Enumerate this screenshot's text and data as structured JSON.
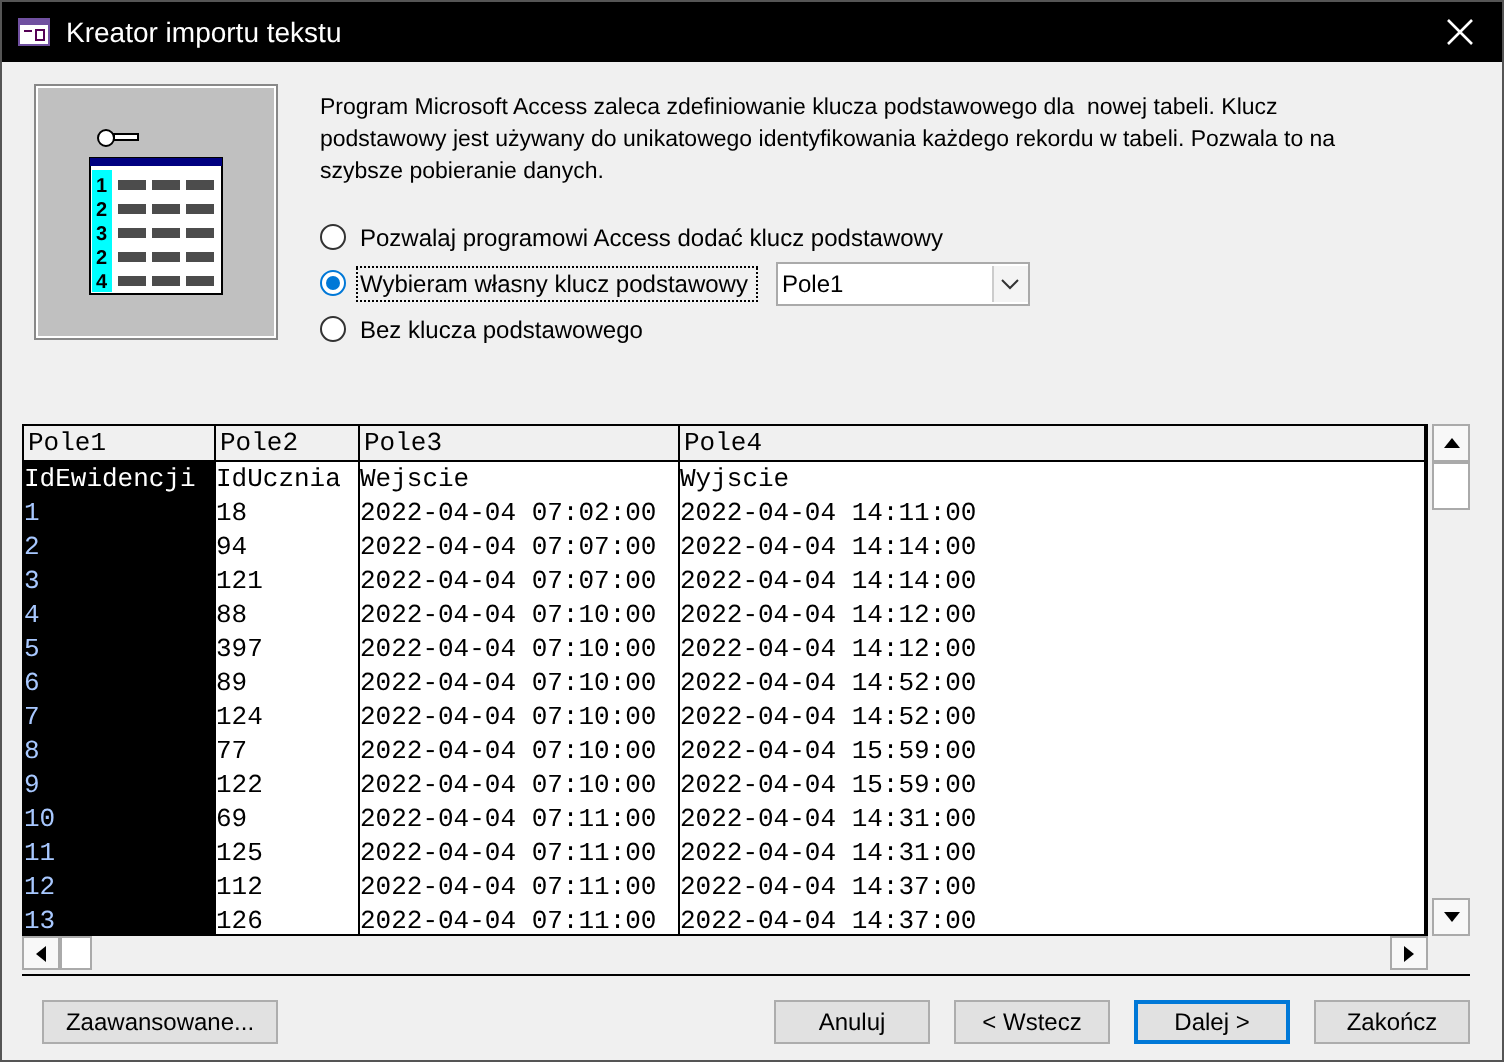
{
  "window": {
    "title": "Kreator importu tekstu"
  },
  "description": "Program Microsoft Access zaleca zdefiniowanie klucza podstawowego dla  nowej tabeli. Klucz podstawowy jest używany do unikatowego identyfikowania każdego rekordu w tabeli. Pozwala to na szybsze pobieranie danych.",
  "illustration": {
    "row_numbers": [
      "1",
      "2",
      "3",
      "2",
      "4"
    ]
  },
  "options": [
    {
      "label": "Pozwalaj programowi Access dodać klucz podstawowy",
      "selected": false
    },
    {
      "label": "Wybieram własny klucz podstawowy",
      "selected": true
    },
    {
      "label": "Bez klucza podstawowego",
      "selected": false
    }
  ],
  "key_field": {
    "value": "Pole1"
  },
  "table": {
    "columns": [
      {
        "label": "Pole1",
        "selected": true
      },
      {
        "label": "Pole2",
        "selected": false
      },
      {
        "label": "Pole3",
        "selected": false
      },
      {
        "label": "Pole4",
        "selected": false
      }
    ],
    "rows": [
      [
        "IdEwidencji",
        "IdUcznia",
        "Wejscie",
        "Wyjscie"
      ],
      [
        "1",
        "18",
        "2022-04-04 07:02:00",
        "2022-04-04 14:11:00"
      ],
      [
        "2",
        "94",
        "2022-04-04 07:07:00",
        "2022-04-04 14:14:00"
      ],
      [
        "3",
        "121",
        "2022-04-04 07:07:00",
        "2022-04-04 14:14:00"
      ],
      [
        "4",
        "88",
        "2022-04-04 07:10:00",
        "2022-04-04 14:12:00"
      ],
      [
        "5",
        "397",
        "2022-04-04 07:10:00",
        "2022-04-04 14:12:00"
      ],
      [
        "6",
        "89",
        "2022-04-04 07:10:00",
        "2022-04-04 14:52:00"
      ],
      [
        "7",
        "124",
        "2022-04-04 07:10:00",
        "2022-04-04 14:52:00"
      ],
      [
        "8",
        "77",
        "2022-04-04 07:10:00",
        "2022-04-04 15:59:00"
      ],
      [
        "9",
        "122",
        "2022-04-04 07:10:00",
        "2022-04-04 15:59:00"
      ],
      [
        "10",
        "69",
        "2022-04-04 07:11:00",
        "2022-04-04 14:31:00"
      ],
      [
        "11",
        "125",
        "2022-04-04 07:11:00",
        "2022-04-04 14:31:00"
      ],
      [
        "12",
        "112",
        "2022-04-04 07:11:00",
        "2022-04-04 14:37:00"
      ],
      [
        "13",
        "126",
        "2022-04-04 07:11:00",
        "2022-04-04 14:37:00"
      ]
    ]
  },
  "buttons": [
    {
      "label": "Zaawansowane...",
      "kind": "left",
      "focused": false
    },
    {
      "label": "Anuluj",
      "kind": "right",
      "focused": false
    },
    {
      "label": "< Wstecz",
      "kind": "right",
      "focused": false
    },
    {
      "label": "Dalej >",
      "kind": "right",
      "focused": true
    },
    {
      "label": "Zakończ",
      "kind": "right",
      "focused": false
    }
  ]
}
